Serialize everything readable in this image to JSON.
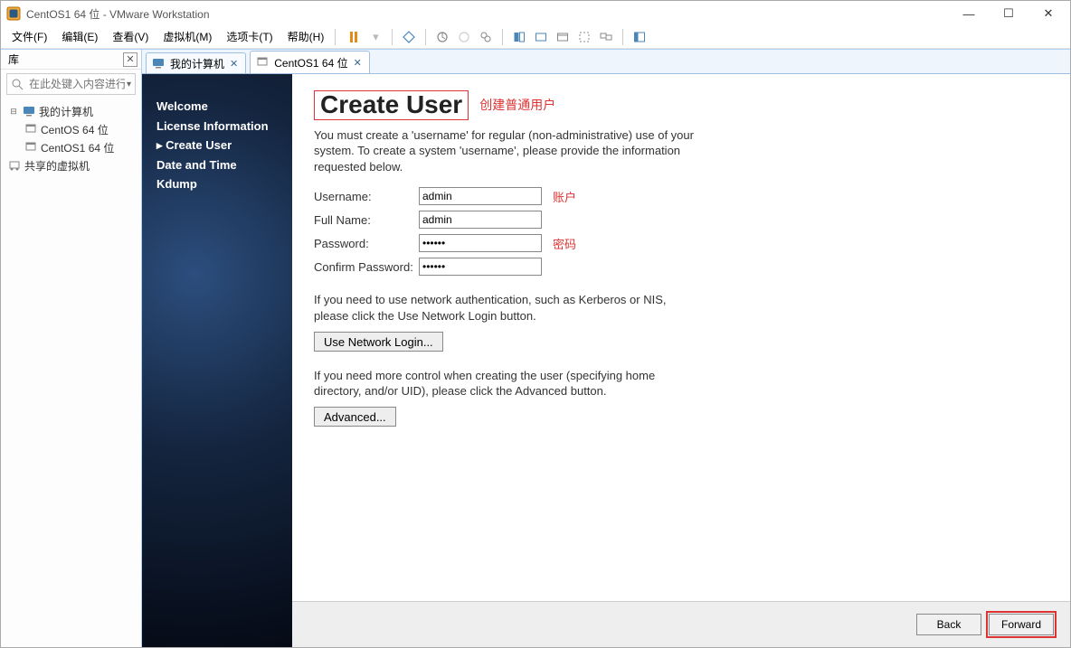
{
  "window": {
    "title": "CentOS1 64 位 - VMware Workstation",
    "min_tip": "最小化",
    "max_tip": "最大化",
    "close_tip": "关闭"
  },
  "menubar": {
    "items": [
      "文件(F)",
      "编辑(E)",
      "查看(V)",
      "虚拟机(M)",
      "选项卡(T)",
      "帮助(H)"
    ]
  },
  "library": {
    "title": "库",
    "search_placeholder": "在此处键入内容进行...",
    "tree": {
      "root": "我的计算机",
      "children": [
        "CentOS 64 位",
        "CentOS1 64 位"
      ],
      "shared": "共享的虚拟机"
    }
  },
  "tabs": {
    "home": "我的计算机",
    "vm": "CentOS1 64 位"
  },
  "guest": {
    "sidebar": {
      "items": [
        "Welcome",
        "License Information",
        "Create User",
        "Date and Time",
        "Kdump"
      ],
      "active_index": 2
    },
    "content": {
      "heading": "Create User",
      "heading_annotation": "创建普通用户",
      "desc": "You must create a 'username' for regular (non-administrative) use of your system.  To create a system 'username', please provide the information requested below.",
      "fields": {
        "username_label": "Username:",
        "username_value": "admin",
        "username_ann": "账户",
        "fullname_label": "Full Name:",
        "fullname_value": "admin",
        "password_label": "Password:",
        "password_value": "••••••",
        "password_ann": "密码",
        "confirm_label": "Confirm Password:",
        "confirm_value": "••••••"
      },
      "net_text": "If you need to use network authentication, such as Kerberos or NIS, please click the Use Network Login button.",
      "net_btn": "Use Network Login...",
      "adv_text": "If you need more control when creating the user (specifying home directory, and/or UID), please click the Advanced button.",
      "adv_btn": "Advanced...",
      "back": "Back",
      "forward": "Forward"
    }
  }
}
